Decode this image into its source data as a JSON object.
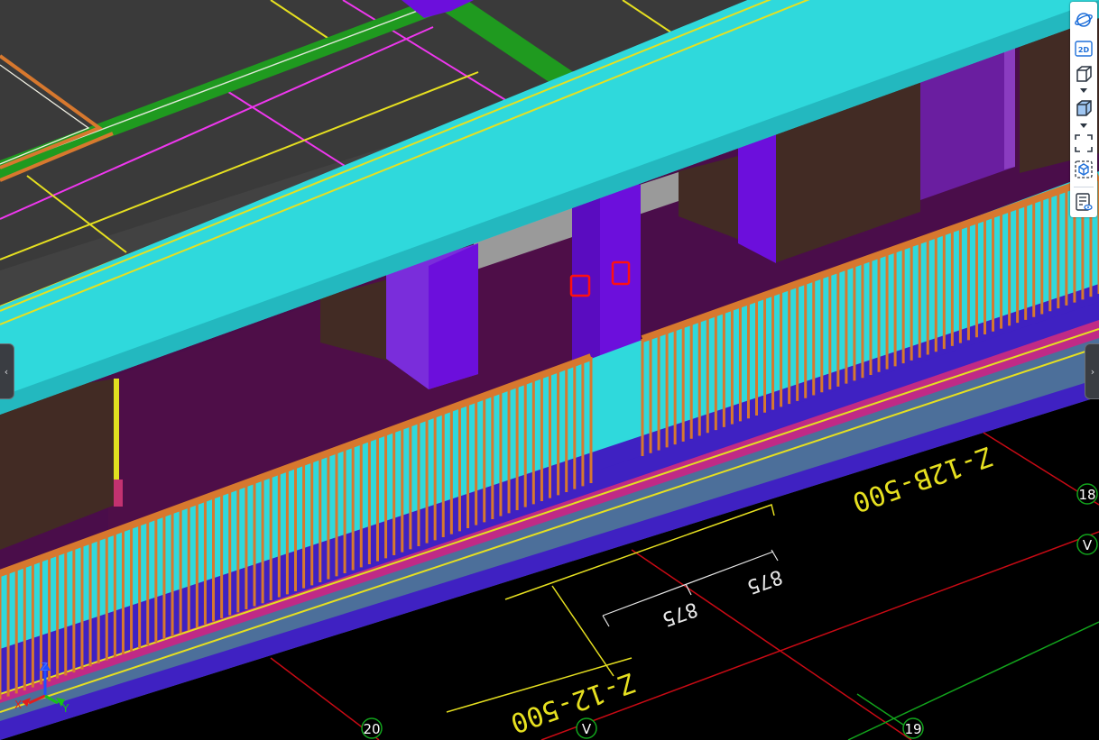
{
  "viewport": {
    "dimension_labels": {
      "beam_upper": "Z-12B-500",
      "beam_lower": "Z-12-500",
      "dim_left": "875",
      "dim_right": "875"
    },
    "grid_bubbles": {
      "b18": "18",
      "bv_right": "V",
      "b20": "20",
      "bv_bottom": "V",
      "b19": "19"
    },
    "axis_triad": {
      "x": "X",
      "y": "Y",
      "z": "Z"
    }
  },
  "toolbar": {
    "twod_label": "2D",
    "icons": [
      "orbit-icon",
      "2d-view-icon",
      "wireframe-cube-icon",
      "chevron-down-icon",
      "shaded-cube-icon",
      "chevron-down-icon",
      "fit-view-icon",
      "section-box-icon",
      "properties-panel-icon"
    ]
  },
  "side_handles": {
    "left": "‹",
    "right": "›"
  },
  "colors": {
    "slab": "#3c3c3c",
    "beam_cyan": "#2fd9dc",
    "column_purple": "#6c0fdc",
    "railing_orange": "#d7782e",
    "wall_brown": "#422b24",
    "grid_red": "#c80a14",
    "grid_green": "#12a41c",
    "annotation_yellow": "#e6e020",
    "magenta_line": "#ef37ef",
    "green_beam": "#1f9a1f",
    "accent_blue": "#1e6fd9"
  }
}
